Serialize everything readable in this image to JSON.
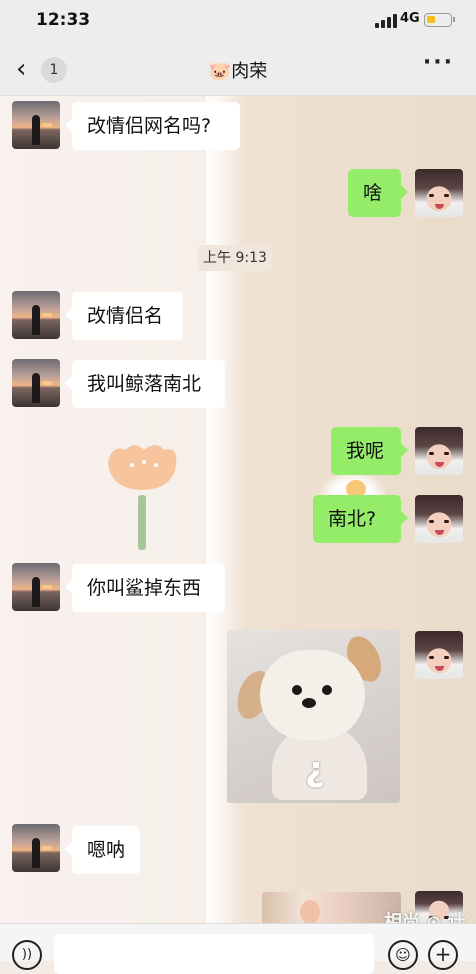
{
  "status_bar": {
    "time": "12:33",
    "network": "4G"
  },
  "nav": {
    "back_icon": "chevron-left-icon",
    "unread_count": "1",
    "title_emoji": "🐷",
    "title": "肉荣",
    "more_icon": "more-icon"
  },
  "messages": [
    {
      "side": "left",
      "text": "改情侣网名吗?"
    },
    {
      "side": "right",
      "text": "啥"
    },
    {
      "side": "left",
      "text": "改情侣名"
    },
    {
      "side": "left",
      "text": "我叫鲸落南北"
    },
    {
      "side": "right",
      "text": "我呢"
    },
    {
      "side": "right",
      "text": "南北?"
    },
    {
      "side": "left",
      "text": "你叫鲨掉东西"
    },
    {
      "side": "right",
      "type": "sticker",
      "text": "¿"
    },
    {
      "side": "left",
      "text": "嗯呐"
    },
    {
      "side": "right",
      "type": "image"
    }
  ],
  "timestamp": "上午 9:13",
  "input_bar": {
    "voice_icon": "voice-icon",
    "emoji_icon": "emoji-icon",
    "plus_icon": "plus-icon"
  },
  "watermark": "相尚 ⊙ 计",
  "colors": {
    "bubble_self": "#95ec69",
    "bubble_other": "#ffffff",
    "bar_bg": "#ededed"
  }
}
